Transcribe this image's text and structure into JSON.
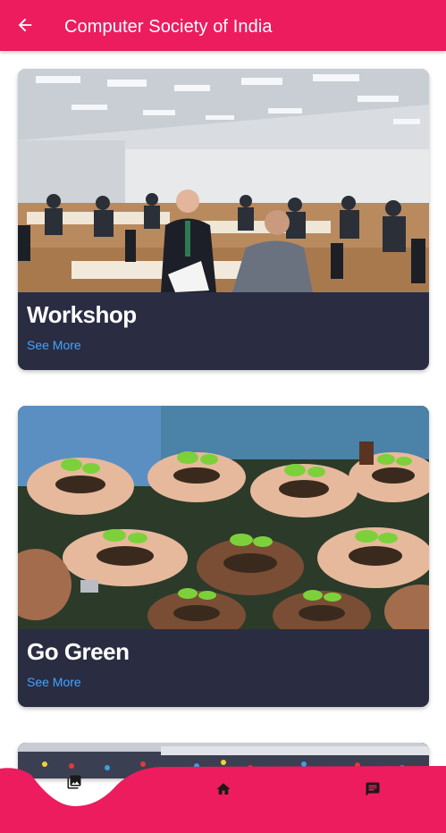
{
  "header": {
    "title": "Computer Society of India",
    "back_icon": "arrow-left-icon",
    "background_color": "#ec1c5e"
  },
  "cards": [
    {
      "title": "Workshop",
      "link_label": "See More",
      "image": "conference-room-photo"
    },
    {
      "title": "Go Green",
      "link_label": "See More",
      "image": "hands-holding-seedlings-photo"
    },
    {
      "title": "",
      "link_label": "",
      "image": "event-hall-photo"
    }
  ],
  "bottom_nav": {
    "items": [
      {
        "icon": "gallery-icon",
        "active": true
      },
      {
        "icon": "home-icon",
        "active": false
      },
      {
        "icon": "chat-icon",
        "active": false
      }
    ],
    "background_color": "#ec1c5e"
  },
  "colors": {
    "card_background": "#2a2c42",
    "link": "#42a5ff"
  }
}
